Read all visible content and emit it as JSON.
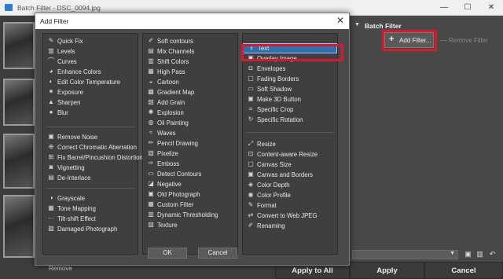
{
  "window": {
    "title": "Batch Filter - DSC_0094.jpg",
    "controls": [
      "—",
      "☐",
      "✕"
    ]
  },
  "panel": {
    "section_title": "Batch Filter",
    "add_filter_label": "Add Filter...",
    "remove_filter_label": "Remove Filter",
    "bottom_buttons": [
      "Apply to All",
      "Apply",
      "Cancel"
    ],
    "left_remove_label": "Remove"
  },
  "dialog": {
    "title": "Add Filter",
    "close": "✕",
    "ok_label": "OK",
    "cancel_label": "Cancel",
    "columns": [
      {
        "groups": [
          [
            {
              "label": "Quick Fix",
              "icon": "✎"
            },
            {
              "label": "Levels",
              "icon": "▥"
            },
            {
              "label": "Curves",
              "icon": "⌒"
            },
            {
              "label": "Enhance Colors",
              "icon": "◕"
            },
            {
              "label": "Edit Color Temperature",
              "icon": "◐"
            },
            {
              "label": "Exposure",
              "icon": "✷"
            },
            {
              "label": "Sharpen",
              "icon": "▲"
            },
            {
              "label": "Blur",
              "icon": "●"
            }
          ],
          [
            {
              "label": "Remove Noise",
              "icon": "▣"
            },
            {
              "label": "Correct Chromatic Aberration",
              "icon": "⊕"
            },
            {
              "label": "Fix Barrel/Pincushion Distortion",
              "icon": "⊞"
            },
            {
              "label": "Vignetting",
              "icon": "◙"
            },
            {
              "label": "De-Interlace",
              "icon": "▤"
            }
          ],
          [
            {
              "label": "Grayscale",
              "icon": "◑"
            },
            {
              "label": "Tone Mapping",
              "icon": "▦"
            },
            {
              "label": "Tilt-shift Effect",
              "icon": "⋯"
            },
            {
              "label": "Damaged Photograph",
              "icon": "▨"
            }
          ]
        ]
      },
      {
        "groups": [
          [
            {
              "label": "Soft contours",
              "icon": "✐"
            },
            {
              "label": "Mix Channels",
              "icon": "▤"
            },
            {
              "label": "Shift Colors",
              "icon": "▥"
            },
            {
              "label": "High Pass",
              "icon": "▦"
            },
            {
              "label": "Cartoon",
              "icon": "◒"
            },
            {
              "label": "Gradient Map",
              "icon": "▩"
            },
            {
              "label": "Add Grain",
              "icon": "▨"
            },
            {
              "label": "Explosion",
              "icon": "✺"
            },
            {
              "label": "Oil Painting",
              "icon": "◍"
            },
            {
              "label": "Waves",
              "icon": "≈"
            },
            {
              "label": "Pencil Drawing",
              "icon": "✏"
            },
            {
              "label": "Pixelize",
              "icon": "▧"
            },
            {
              "label": "Emboss",
              "icon": "✑"
            },
            {
              "label": "Detect Contours",
              "icon": "▭"
            },
            {
              "label": "Negative",
              "icon": "◪"
            },
            {
              "label": "Old Photograph",
              "icon": "▣"
            },
            {
              "label": "Custom Filter",
              "icon": "▦"
            },
            {
              "label": "Dynamic Thresholding",
              "icon": "▥"
            },
            {
              "label": "Texture",
              "icon": "▨"
            }
          ]
        ]
      },
      {
        "groups": [
          [
            {
              "label": "Text",
              "icon": "Ŧ",
              "selected": true
            },
            {
              "label": "Overlay Image",
              "icon": "▣"
            },
            {
              "label": "Envelopes",
              "icon": "◘"
            },
            {
              "label": "Fading Borders",
              "icon": "▢"
            },
            {
              "label": "Soft Shadow",
              "icon": "▭"
            },
            {
              "label": "Make 3D Button",
              "icon": "▣"
            },
            {
              "label": "Specific Crop",
              "icon": "⌗"
            },
            {
              "label": "Specific Rotation",
              "icon": "↻"
            }
          ],
          [
            {
              "label": "Resize",
              "icon": "⤢"
            },
            {
              "label": "Content-aware Resize",
              "icon": "⊡"
            },
            {
              "label": "Canvas Size",
              "icon": "▢"
            },
            {
              "label": "Canvas and Borders",
              "icon": "▣"
            },
            {
              "label": "Color Depth",
              "icon": "◈"
            },
            {
              "label": "Color Profile",
              "icon": "◉"
            },
            {
              "label": "Format",
              "icon": "✎"
            },
            {
              "label": "Convert to Web JPEG",
              "icon": "⇄"
            },
            {
              "label": "Renaming",
              "icon": "✐"
            }
          ]
        ]
      }
    ]
  }
}
